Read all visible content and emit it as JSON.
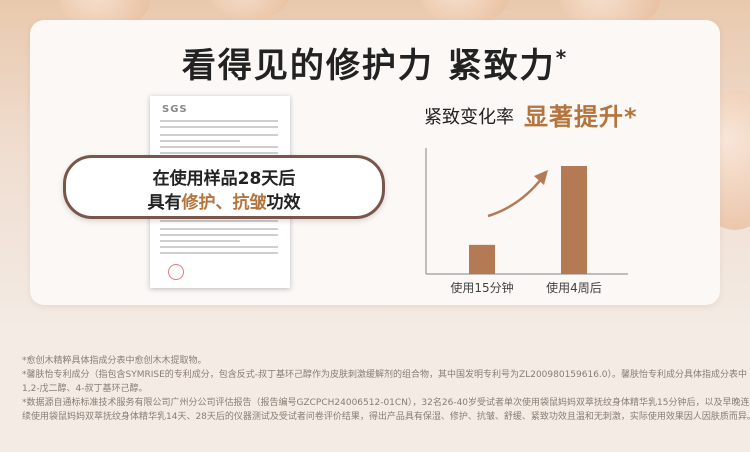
{
  "headline": {
    "text": "看得见的修护力  紧致力",
    "mark": "*"
  },
  "callout": {
    "line1": "在使用样品28天后",
    "line2_prefix": "具有",
    "line2_accent1": "修护",
    "line2_sep": "、",
    "line2_accent2": "抗皱",
    "line2_suffix": "功效"
  },
  "report": {
    "logo": "SGS"
  },
  "chart_data": {
    "type": "bar",
    "title": "紧致变化率",
    "emphasis": "显著提升*",
    "categories": [
      "使用15分钟",
      "使用4周后"
    ],
    "values": [
      1,
      2
    ],
    "color": "#b37a54"
  },
  "footnotes": [
    "*愈创木精粹具体指成分表中愈创木木提取物。",
    "*馨肤怡专利成分（指包含SYMRISE的专利成分，包含反式-叔丁基环己醇作为皮肤刺激缓解剂的组合物，其中国发明专利号为ZL200980159616.0）。馨肤怡专利成分具体指成分表中",
    "1,2-戊二醇、4-叔丁基环己醇。",
    "*数据源自通标标准技术服务有限公司广州分公司评估报告（报告编号GZCPCH24006512-01CN），32名26-40岁受试者单次使用袋鼠妈妈双萃抚纹身体精华乳15分钟后，以及早晚连",
    "续使用袋鼠妈妈双萃抚纹身体精华乳14天、28天后的仪器测试及受试者问卷评价结果，得出产品具有保湿、修护、抗皱、舒缓、紧致功效且温和无刺激，实际使用效果因人因肤质而异。"
  ]
}
